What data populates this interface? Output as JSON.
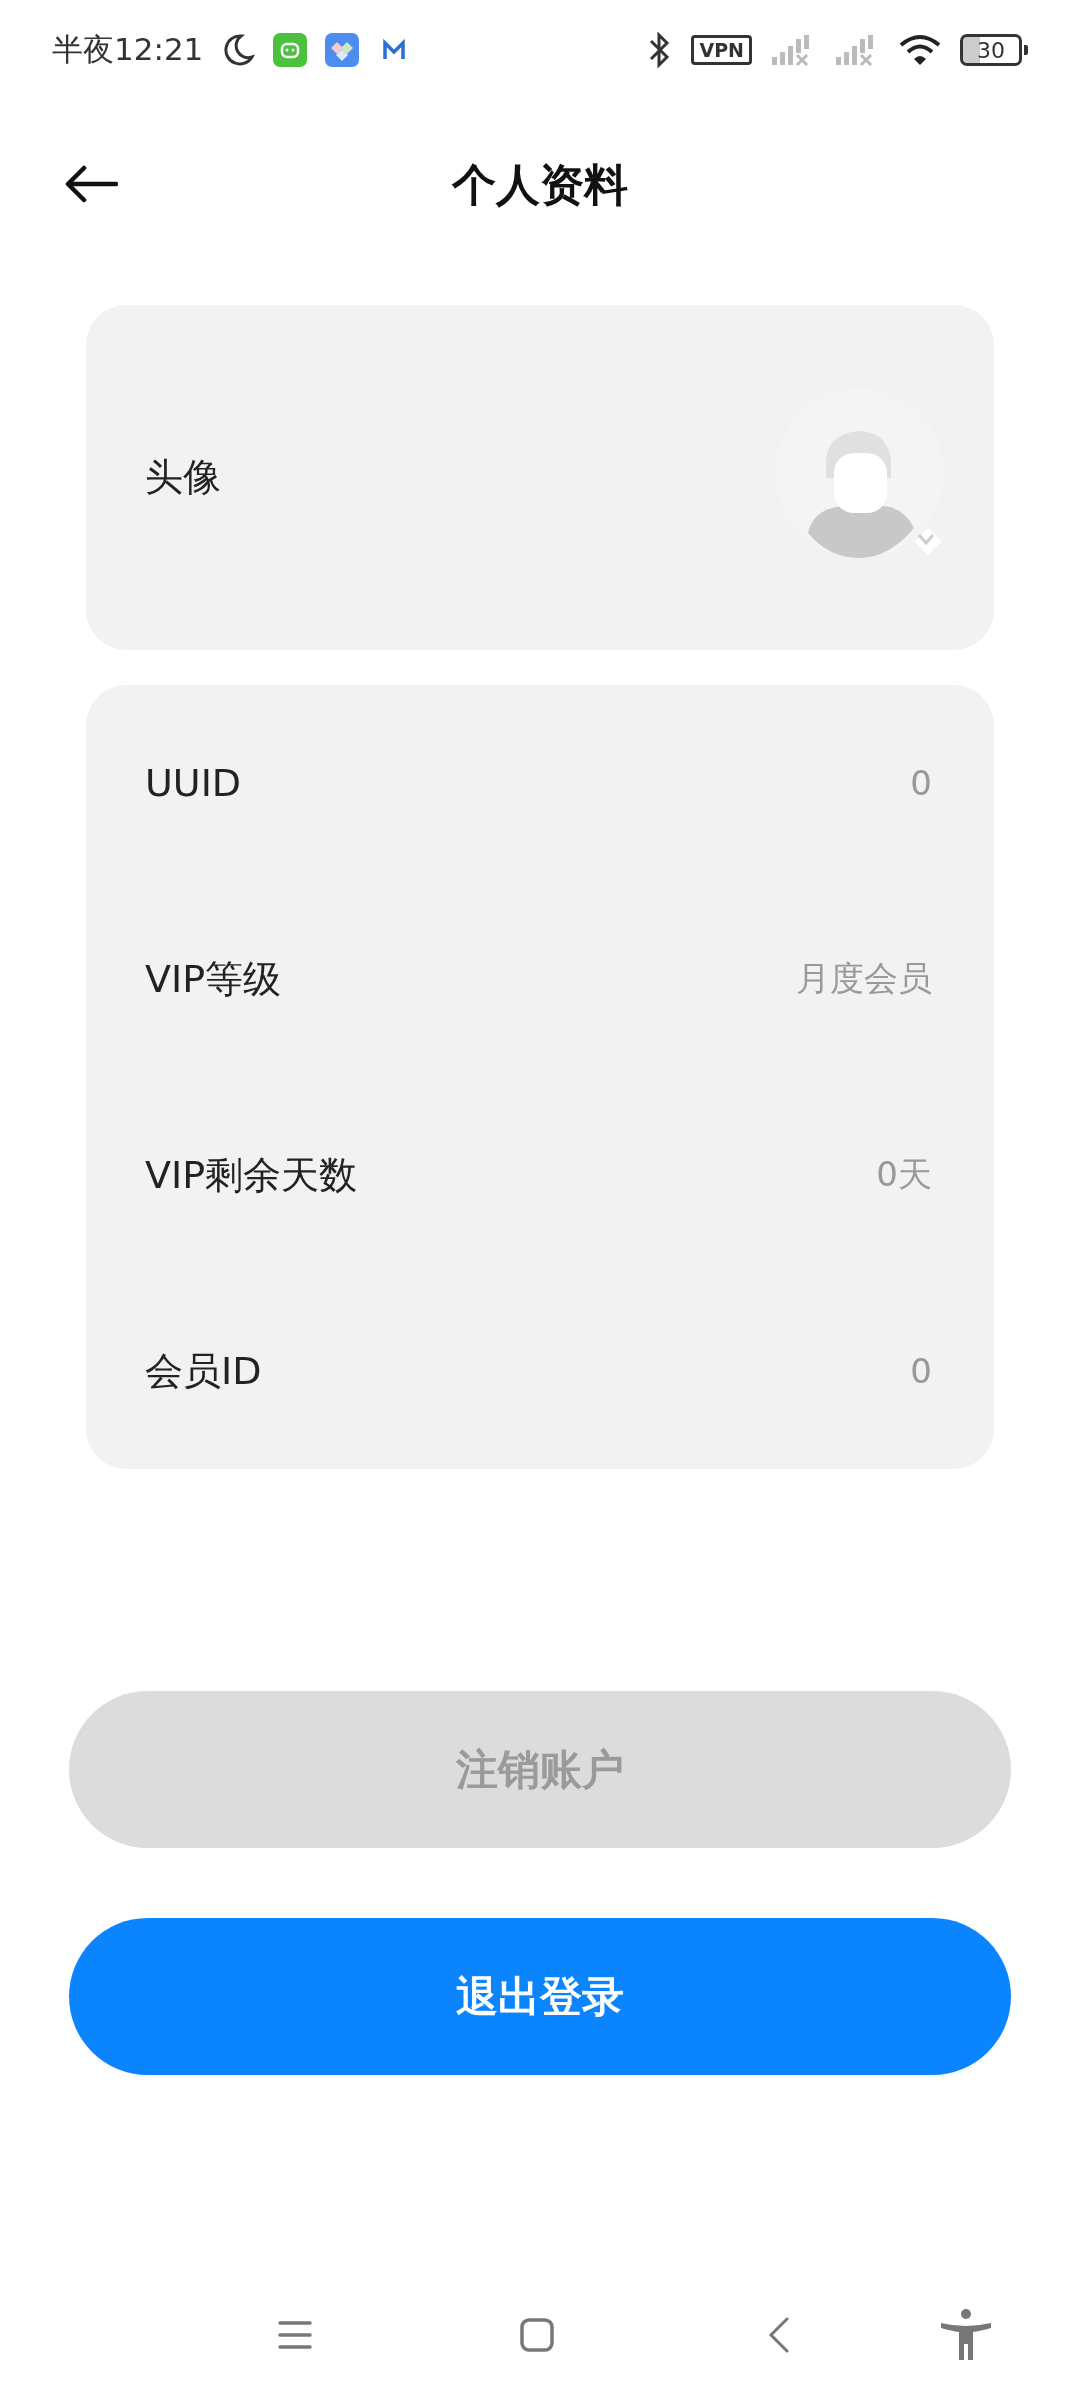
{
  "status_bar": {
    "time": "半夜12:21",
    "vpn": "VPN",
    "battery": "30"
  },
  "header": {
    "title": "个人资料"
  },
  "avatar_row": {
    "label": "头像"
  },
  "info_rows": [
    {
      "label": "UUID",
      "value": "0"
    },
    {
      "label": "VIP等级",
      "value": "月度会员"
    },
    {
      "label": "VIP剩余天数",
      "value": "0天"
    },
    {
      "label": "会员ID",
      "value": "0"
    }
  ],
  "buttons": [
    {
      "label": "注销账户",
      "kind": "secondary"
    },
    {
      "label": "退出登录",
      "kind": "primary"
    }
  ]
}
